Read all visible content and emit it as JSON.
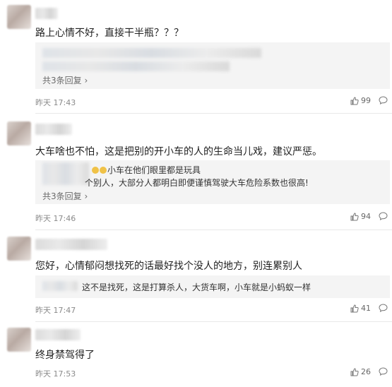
{
  "comments": [
    {
      "text": "路上心情不好，直接干半瓶？？？",
      "reply_count": "共3条回复",
      "reply_arrow": "›",
      "time": "昨天 17:43",
      "likes": "99"
    },
    {
      "text": "大车啥也不怕，这是把别的开小车的人的生命当儿戏，建议严惩。",
      "reply_line1": "小车在他们眼里都是玩具",
      "reply_line2": "个别人，大部分人都明白即便谨慎驾驶大车危险系数也很高!",
      "reply_count": "共3条回复",
      "reply_arrow": "›",
      "time": "昨天 17:46",
      "likes": "94"
    },
    {
      "text": "您好，心情郁闷想找死的话最好找个没人的地方，别连累别人",
      "reply_line1": "这不是找死，这是打算杀人，大货车啊，小车就是小蚂蚁一样",
      "time": "昨天 17:47",
      "likes": "41"
    },
    {
      "text": "终身禁驾得了",
      "time": "昨天 17:53",
      "likes": "26"
    }
  ]
}
